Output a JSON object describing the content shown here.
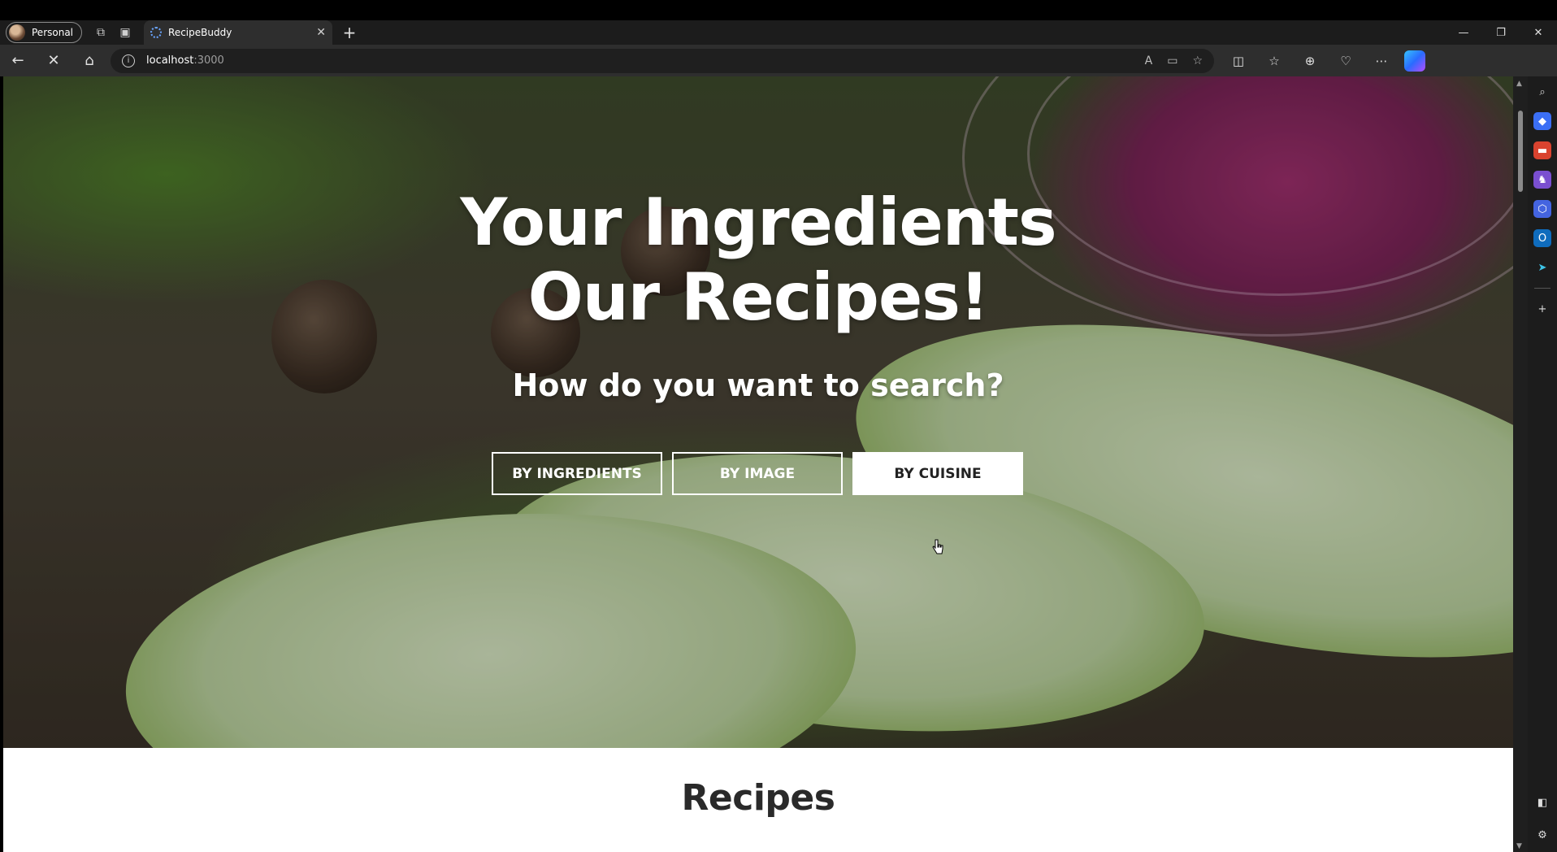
{
  "browser": {
    "profile_label": "Personal",
    "tab_title": "RecipeBuddy",
    "url_host": "localhost",
    "url_port": ":3000",
    "window_controls": [
      "—",
      "❐",
      "✕"
    ]
  },
  "hero": {
    "title_line1": "Your Ingredients",
    "title_line2": "Our Recipes!",
    "subtitle": "How do you want to search?",
    "buttons": [
      {
        "label": "BY INGREDIENTS"
      },
      {
        "label": "BY IMAGE"
      },
      {
        "label": "BY CUISINE"
      }
    ]
  },
  "section": {
    "title": "Recipes"
  },
  "icons": {
    "sidebar": [
      "search-icon",
      "tag-icon",
      "briefcase-icon",
      "chess-icon",
      "m365-icon",
      "outlook-icon",
      "send-icon",
      "add-icon"
    ]
  }
}
